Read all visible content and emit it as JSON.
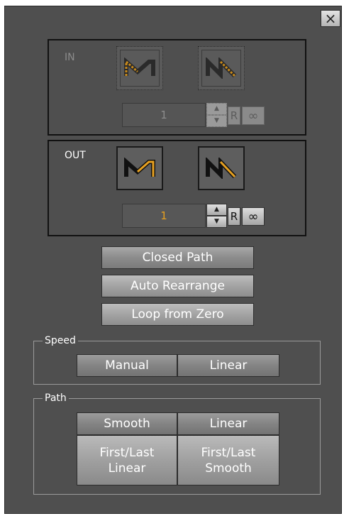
{
  "window": {
    "close_glyph": "×"
  },
  "in_group": {
    "label": "IN",
    "ease_in_icon": "ease-in-out-m-icon",
    "ease_out_icon": "ease-n-icon",
    "value": "1",
    "spin_up": "▲",
    "spin_down": "▼",
    "repeat_label": "R",
    "infinite_label": "∞",
    "state": "disabled"
  },
  "out_group": {
    "label": "OUT",
    "ease_in_icon": "ease-in-out-m-icon",
    "ease_out_icon": "ease-n-icon",
    "value": "1",
    "spin_up": "▲",
    "spin_down": "▼",
    "repeat_label": "R",
    "infinite_label": "∞",
    "state": "enabled"
  },
  "buttons": {
    "closed_path": "Closed Path",
    "auto_rearrange": "Auto Rearrange",
    "loop_from_zero": "Loop from Zero"
  },
  "speed": {
    "legend": "Speed",
    "manual": "Manual",
    "linear": "Linear"
  },
  "path": {
    "legend": "Path",
    "smooth": "Smooth",
    "linear": "Linear",
    "first_last_linear": "First/Last\nLinear",
    "first_last_smooth": "First/Last\nSmooth"
  },
  "colors": {
    "panel_bg": "#4f4f4f",
    "accent_orange": "#e6a020",
    "disabled_text": "#8c8c8c"
  }
}
